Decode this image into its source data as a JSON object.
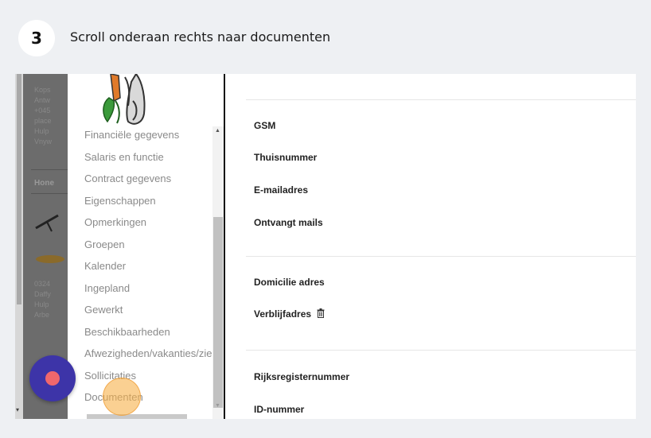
{
  "step": {
    "number": "3",
    "instruction": "Scroll onderaan rechts naar documenten"
  },
  "menu": {
    "items": [
      "Financiële gegevens",
      "Salaris en functie",
      "Contract gegevens",
      "Eigenschappen",
      "Opmerkingen",
      "Groepen",
      "Kalender",
      "Ingepland",
      "Gewerkt",
      "Beschikbaarheden",
      "Afwezigheden/vakanties/zie",
      "Sollicitaties",
      "Documenten"
    ]
  },
  "sidebar_partial": {
    "lines_top": [
      "Kops",
      "Antw",
      "+045",
      "place",
      "Hulp",
      "Vnyw"
    ],
    "header": "Hone",
    "lines_bottom": [
      "0324",
      "Daffy",
      "Hulp",
      "Arbe"
    ]
  },
  "form": {
    "gsm": "GSM",
    "thuisnummer": "Thuisnummer",
    "email": "E-mailadres",
    "ontvangt_mails": "Ontvangt mails",
    "domicilie": "Domicilie adres",
    "verblijf": "Verblijfadres",
    "rijksregister": "Rijksregisternummer",
    "id_nummer": "ID-nummer"
  },
  "icons": {
    "trash": "trash-icon",
    "fab": "record-icon",
    "logo": "carrot-mascot-icon"
  },
  "colors": {
    "fab": "#3d34a8",
    "fab_dot": "#f0676c",
    "highlight": "#f7b04a"
  }
}
